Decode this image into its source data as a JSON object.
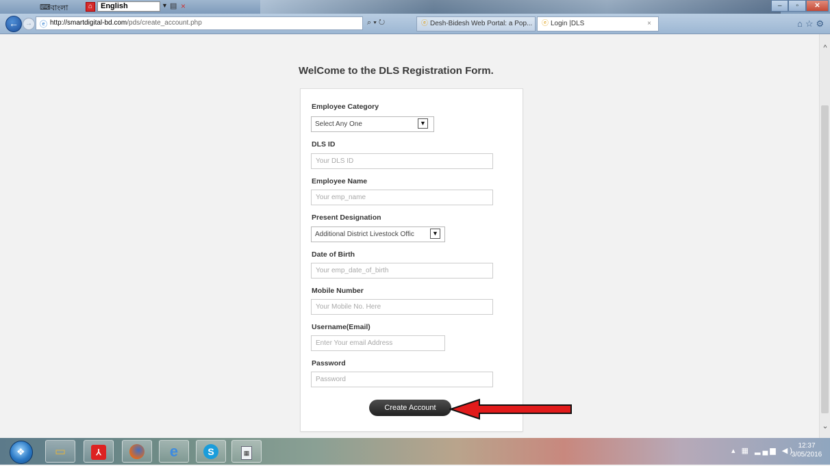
{
  "browser": {
    "language_bar": {
      "bangla_label": "বাংলা",
      "language_value": "English"
    },
    "address_url_domain": "http://smartdigital-bd.com",
    "address_url_path": "/pds/create_account.php",
    "search_icon": "⌕ ▾ ↻",
    "tabs": [
      {
        "label": "Desh-Bidesh Web Portal: a Pop..."
      },
      {
        "label": "Login |DLS"
      }
    ],
    "tab_close": "×"
  },
  "page": {
    "title": "WelCome to the DLS Registration Form."
  },
  "form": {
    "employee_category": {
      "label": "Employee Category",
      "value": "Select Any One"
    },
    "dls_id": {
      "label": "DLS ID",
      "placeholder": "Your DLS ID"
    },
    "employee_name": {
      "label": "Employee Name",
      "placeholder": "Your emp_name"
    },
    "present_designation": {
      "label": "Present Designation",
      "value": "Additional District Livestock Offic"
    },
    "date_of_birth": {
      "label": "Date of Birth",
      "placeholder": "Your emp_date_of_birth"
    },
    "mobile_number": {
      "label": "Mobile Number",
      "placeholder": "Your Mobile No. Here"
    },
    "username": {
      "label": "Username(Email)",
      "placeholder": "Enter Your email Address"
    },
    "password": {
      "label": "Password",
      "placeholder": "Password"
    },
    "submit_label": "Create Account"
  },
  "taskbar": {
    "clock_time": "12:37",
    "clock_date": "3/05/2016"
  },
  "colors": {
    "arrow": "#e11b1b",
    "button": "#333333",
    "taskbar_orb": "#2a78c4"
  }
}
